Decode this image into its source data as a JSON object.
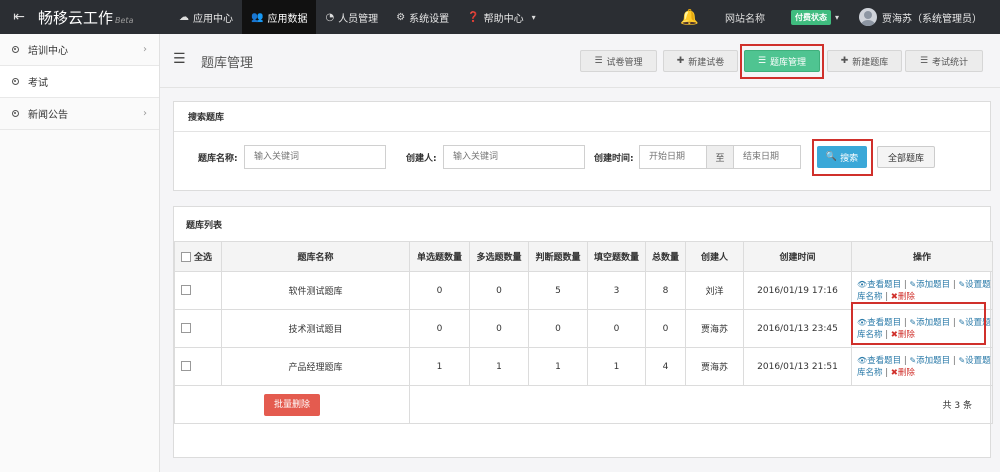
{
  "topbar": {
    "brand": "畅移云工作",
    "brand_suffix": "Beta",
    "nav": [
      {
        "label": "应用中心",
        "icon": "cloud-icon"
      },
      {
        "label": "应用数据",
        "icon": "users-icon",
        "active": true
      },
      {
        "label": "人员管理",
        "icon": "dashboard-icon"
      },
      {
        "label": "系统设置",
        "icon": "gears-icon"
      },
      {
        "label": "帮助中心",
        "icon": "question-icon",
        "has_caret": true
      }
    ],
    "site_name": "网站名称",
    "paid_status": "付费状态",
    "user": "贾海苏（系统管理员）"
  },
  "sidebar": {
    "items": [
      {
        "label": "培训中心",
        "has_arrow": true
      },
      {
        "label": "考试",
        "has_arrow": false,
        "active": true
      },
      {
        "label": "新闻公告",
        "has_arrow": true
      }
    ]
  },
  "page": {
    "title": "题库管理",
    "toolbar": [
      {
        "label": "试卷管理",
        "icon": "list-icon"
      },
      {
        "label": "新建试卷",
        "icon": "plus-icon"
      },
      {
        "label": "题库管理",
        "icon": "list-icon",
        "active": true
      },
      {
        "label": "新建题库",
        "icon": "plus-icon"
      },
      {
        "label": "考试统计",
        "icon": "list-icon"
      }
    ]
  },
  "search": {
    "title": "搜索题库",
    "name_label": "题库名称:",
    "name_placeholder": "输入关键词",
    "creator_label": "创建人:",
    "creator_placeholder": "输入关键词",
    "time_label": "创建时间:",
    "start_placeholder": "开始日期",
    "separator": "至",
    "end_placeholder": "结束日期",
    "search_button": "搜索",
    "all_button": "全部题库"
  },
  "list": {
    "title": "题库列表",
    "select_all": "全选",
    "columns": [
      "题库名称",
      "单选题数量",
      "多选题数量",
      "判断题数量",
      "填空题数量",
      "总数量",
      "创建人",
      "创建时间",
      "操作"
    ],
    "rows": [
      {
        "name": "软件测试题库",
        "single": "0",
        "multi": "0",
        "judge": "5",
        "fill": "3",
        "total": "8",
        "creator": "刘洋",
        "created": "2016/01/19 17:16"
      },
      {
        "name": "技术测试题目",
        "single": "0",
        "multi": "0",
        "judge": "0",
        "fill": "0",
        "total": "0",
        "creator": "贾海苏",
        "created": "2016/01/13 23:45"
      },
      {
        "name": "产品经理题库",
        "single": "1",
        "multi": "1",
        "judge": "1",
        "fill": "1",
        "total": "4",
        "creator": "贾海苏",
        "created": "2016/01/13 21:51"
      }
    ],
    "ops": {
      "view": "查看题目",
      "add": "添加题目",
      "set_name": "设置题库名称",
      "delete": "删除",
      "separator": "|"
    },
    "batch_delete": "批量删除",
    "total": "共 3 条"
  },
  "colors": {
    "topbar": "#2b2e33",
    "active_green": "#4fc491",
    "search_blue": "#3aa8d8",
    "danger_red": "#e45b4f",
    "highlight_red": "#d0302b",
    "link_blue": "#2a7aa8"
  }
}
